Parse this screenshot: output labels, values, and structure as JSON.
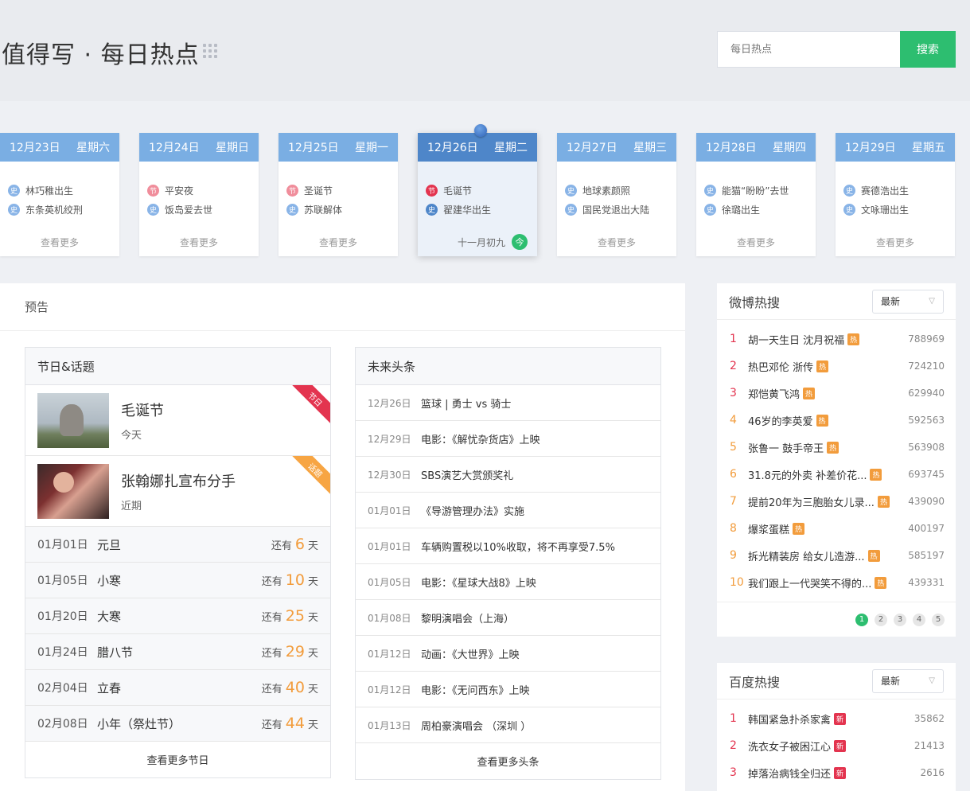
{
  "header": {
    "title": "值得写 · 每日热点",
    "search_placeholder": "每日热点",
    "search_button": "搜索"
  },
  "calendar": [
    {
      "date": "12月23日",
      "weekday": "星期六",
      "items": [
        {
          "tag": "史",
          "text": "林巧稚出生"
        },
        {
          "tag": "史",
          "text": "东条英机绞刑"
        }
      ],
      "more": "查看更多"
    },
    {
      "date": "12月24日",
      "weekday": "星期日",
      "items": [
        {
          "tag": "节",
          "text": "平安夜"
        },
        {
          "tag": "史",
          "text": "饭岛爱去世"
        }
      ],
      "more": "查看更多"
    },
    {
      "date": "12月25日",
      "weekday": "星期一",
      "items": [
        {
          "tag": "节",
          "text": "圣诞节"
        },
        {
          "tag": "史",
          "text": "苏联解体"
        }
      ],
      "more": "查看更多"
    },
    {
      "date": "12月26日",
      "weekday": "星期二",
      "items": [
        {
          "tag": "节",
          "text": "毛诞节"
        },
        {
          "tag": "史",
          "text": "翟建华出生"
        }
      ],
      "lunar": "十一月初九",
      "today_badge": "今"
    },
    {
      "date": "12月27日",
      "weekday": "星期三",
      "items": [
        {
          "tag": "史",
          "text": "地球素颜照"
        },
        {
          "tag": "史",
          "text": "国民党退出大陆"
        }
      ],
      "more": "查看更多"
    },
    {
      "date": "12月28日",
      "weekday": "星期四",
      "items": [
        {
          "tag": "史",
          "text": "能猫“盼盼”去世"
        },
        {
          "tag": "史",
          "text": "徐璐出生"
        }
      ],
      "more": "查看更多"
    },
    {
      "date": "12月29日",
      "weekday": "星期五",
      "items": [
        {
          "tag": "史",
          "text": "赛德浩出生"
        },
        {
          "tag": "史",
          "text": "文咏珊出生"
        }
      ],
      "more": "查看更多"
    }
  ],
  "preview": {
    "title": "预告",
    "holidays": {
      "title": "节日&话题",
      "featured": [
        {
          "title": "毛诞节",
          "sub": "今天",
          "corner": "节日"
        },
        {
          "title": "张翰娜扎宣布分手",
          "sub": "近期",
          "corner": "话题"
        }
      ],
      "left_label": "还有",
      "unit": "天",
      "rows": [
        {
          "date": "01月01日",
          "name": "元旦",
          "days": "6"
        },
        {
          "date": "01月05日",
          "name": "小寒",
          "days": "10"
        },
        {
          "date": "01月20日",
          "name": "大寒",
          "days": "25"
        },
        {
          "date": "01月24日",
          "name": "腊八节",
          "days": "29"
        },
        {
          "date": "02月04日",
          "name": "立春",
          "days": "40"
        },
        {
          "date": "02月08日",
          "name": "小年（祭灶节）",
          "days": "44"
        }
      ],
      "more": "查看更多节日"
    },
    "headlines": {
      "title": "未来头条",
      "rows": [
        {
          "date": "12月26日",
          "title": "篮球 | 勇士 vs 骑士"
        },
        {
          "date": "12月29日",
          "title": "电影：《解忧杂货店》上映"
        },
        {
          "date": "12月30日",
          "title": "SBS演艺大赏颁奖礼"
        },
        {
          "date": "01月01日",
          "title": "《导游管理办法》实施"
        },
        {
          "date": "01月01日",
          "title": "车辆购置税以10%收取，将不再享受7.5%"
        },
        {
          "date": "01月05日",
          "title": "电影：《星球大战8》上映"
        },
        {
          "date": "01月08日",
          "title": "黎明演唱会（上海）"
        },
        {
          "date": "01月12日",
          "title": "动画：《大世界》上映"
        },
        {
          "date": "01月12日",
          "title": "电影：《无问西东》上映"
        },
        {
          "date": "01月13日",
          "title": "周柏豪演唱会 （深圳 ）"
        }
      ],
      "more": "查看更多头条"
    }
  },
  "weibo": {
    "title": "微博热搜",
    "select": "最新",
    "items": [
      {
        "rank": "1",
        "title": "胡一天生日 沈月祝福",
        "badge": "热",
        "count": "788969"
      },
      {
        "rank": "2",
        "title": "热巴邓伦 浙传",
        "badge": "热",
        "count": "724210"
      },
      {
        "rank": "3",
        "title": "郑恺黄飞鸿",
        "badge": "热",
        "count": "629940"
      },
      {
        "rank": "4",
        "title": "46岁的李英爱",
        "badge": "热",
        "count": "592563"
      },
      {
        "rank": "5",
        "title": "张鲁一 鼓手帝王",
        "badge": "热",
        "count": "563908"
      },
      {
        "rank": "6",
        "title": "31.8元的外卖 补差价花...",
        "badge": "热",
        "count": "693745"
      },
      {
        "rank": "7",
        "title": "提前20年为三胞胎女儿录...",
        "badge": "热",
        "count": "439090"
      },
      {
        "rank": "8",
        "title": "爆浆蛋糕",
        "badge": "热",
        "count": "400197"
      },
      {
        "rank": "9",
        "title": "拆光精装房 给女儿造游...",
        "badge": "热",
        "count": "585197"
      },
      {
        "rank": "10",
        "title": "我们跟上一代哭笑不得的...",
        "badge": "热",
        "count": "439331"
      }
    ],
    "pages": [
      "1",
      "2",
      "3",
      "4",
      "5"
    ]
  },
  "baidu": {
    "title": "百度热搜",
    "select": "最新",
    "items": [
      {
        "rank": "1",
        "title": "韩国紧急扑杀家禽",
        "badge": "新",
        "count": "35862"
      },
      {
        "rank": "2",
        "title": "洗衣女子被困江心",
        "badge": "新",
        "count": "21413"
      },
      {
        "rank": "3",
        "title": "掉落治病钱全归还",
        "badge": "新",
        "count": "2616"
      }
    ]
  }
}
